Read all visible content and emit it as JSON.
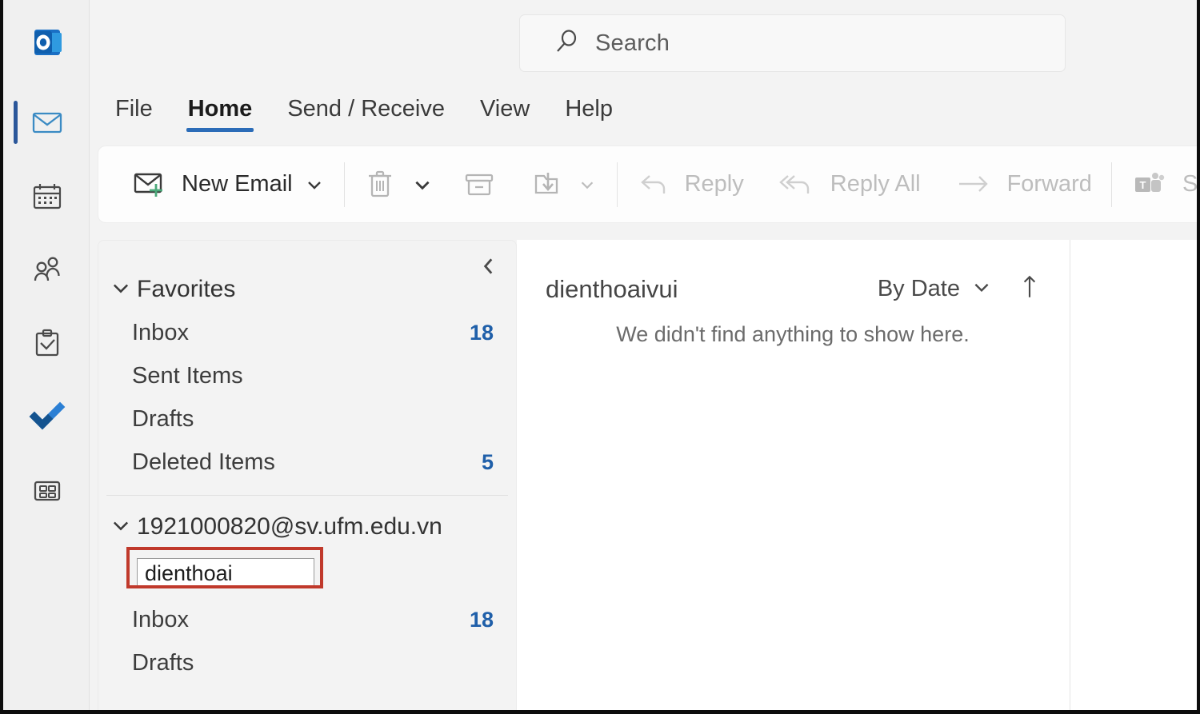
{
  "app": {
    "name": "Microsoft Outlook",
    "logo_icon": "outlook-logo-icon"
  },
  "rail": {
    "items": [
      {
        "id": "mail",
        "label": "Mail",
        "icon": "envelope-icon",
        "selected": true
      },
      {
        "id": "calendar",
        "label": "Calendar",
        "icon": "calendar-icon",
        "selected": false
      },
      {
        "id": "people",
        "label": "People",
        "icon": "people-icon",
        "selected": false
      },
      {
        "id": "tasks",
        "label": "Tasks",
        "icon": "clipboard-check-icon",
        "selected": false
      },
      {
        "id": "todo",
        "label": "To Do",
        "icon": "blue-check-icon",
        "selected": false
      },
      {
        "id": "apps",
        "label": "More apps",
        "icon": "apps-grid-icon",
        "selected": false
      }
    ]
  },
  "search": {
    "placeholder": "Search",
    "icon": "search-icon",
    "value": ""
  },
  "menu": {
    "tabs": [
      {
        "label": "File",
        "active": false
      },
      {
        "label": "Home",
        "active": true
      },
      {
        "label": "Send / Receive",
        "active": false
      },
      {
        "label": "View",
        "active": false
      },
      {
        "label": "Help",
        "active": false
      }
    ]
  },
  "ribbon": {
    "new_email": {
      "label": "New Email",
      "icon": "new-mail-icon",
      "has_dropdown": true
    },
    "delete": {
      "label": "Delete",
      "icon": "trash-icon",
      "has_dropdown": true
    },
    "archive": {
      "label": "Archive",
      "icon": "archive-icon"
    },
    "move": {
      "label": "Move",
      "icon": "move-to-folder-icon",
      "has_dropdown": true
    },
    "reply": {
      "label": "Reply",
      "icon": "reply-icon",
      "disabled": true
    },
    "reply_all": {
      "label": "Reply All",
      "icon": "reply-all-icon",
      "disabled": true
    },
    "forward": {
      "label": "Forward",
      "icon": "forward-arrow-icon",
      "disabled": true
    },
    "teams": {
      "label": "Sh",
      "icon": "teams-icon",
      "disabled": true
    }
  },
  "folder_pane": {
    "collapse_icon": "chevron-left-icon",
    "groups": [
      {
        "title": "Favorites",
        "expanded": true,
        "chevron_icon": "chevron-down-icon",
        "folders": [
          {
            "name": "Inbox",
            "count": "18"
          },
          {
            "name": "Sent Items",
            "count": ""
          },
          {
            "name": "Drafts",
            "count": ""
          },
          {
            "name": "Deleted Items",
            "count": "5"
          }
        ]
      },
      {
        "title": "1921000820@sv.ufm.edu.vn",
        "expanded": true,
        "chevron_icon": "chevron-down-icon",
        "rename_field": {
          "value": "dienthoai",
          "highlighted": true,
          "highlight_color": "#c0392b"
        },
        "folders": [
          {
            "name": "Inbox",
            "count": "18"
          },
          {
            "name": "Drafts",
            "count": ""
          }
        ]
      }
    ]
  },
  "message_list": {
    "folder_title": "dienthoaivui",
    "sort_label": "By Date",
    "sort_chevron_icon": "chevron-down-icon",
    "sort_direction_icon": "arrow-up-icon",
    "empty_text": "We didn't find anything to show here."
  },
  "colors": {
    "accent": "#2b6cb8",
    "count_blue": "#1f5fa9",
    "annotation_red": "#c0392b",
    "rail_selected": "#2b579a",
    "disabled_gray": "#bdbdbd"
  }
}
